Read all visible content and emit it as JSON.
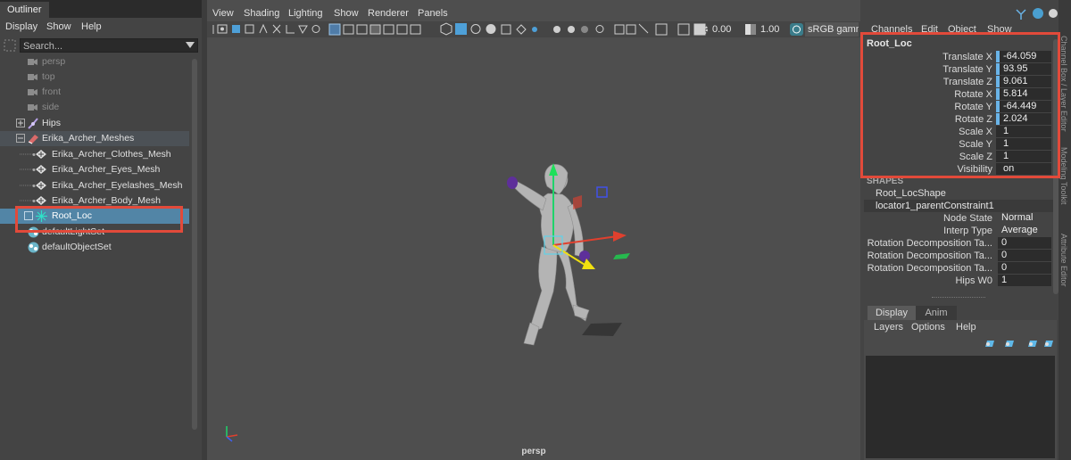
{
  "outliner": {
    "title": "Outliner",
    "menu": [
      "Display",
      "Show",
      "Help"
    ],
    "search_placeholder": "Search...",
    "items": [
      {
        "label": "persp",
        "icon": "camera-icon"
      },
      {
        "label": "top",
        "icon": "camera-icon"
      },
      {
        "label": "front",
        "icon": "camera-icon"
      },
      {
        "label": "side",
        "icon": "camera-icon"
      },
      {
        "label": "Hips",
        "icon": "joint-icon"
      },
      {
        "label": "Erika_Archer_Meshes",
        "icon": "group-icon"
      },
      {
        "label": "Erika_Archer_Clothes_Mesh",
        "icon": "mesh-icon"
      },
      {
        "label": "Erika_Archer_Eyes_Mesh",
        "icon": "mesh-icon"
      },
      {
        "label": "Erika_Archer_Eyelashes_Mesh",
        "icon": "mesh-icon"
      },
      {
        "label": "Erika_Archer_Body_Mesh",
        "icon": "mesh-icon"
      },
      {
        "label": "Root_Loc",
        "icon": "locator-icon"
      },
      {
        "label": "defaultLightSet",
        "icon": "set-icon"
      },
      {
        "label": "defaultObjectSet",
        "icon": "set-icon"
      }
    ]
  },
  "viewport": {
    "menu": [
      "View",
      "Shading",
      "Lighting",
      "Show",
      "Renderer",
      "Panels"
    ],
    "exposure": "0.00",
    "gamma": "1.00",
    "color_space": "sRGB gamm",
    "camera_label": "persp"
  },
  "channel_box": {
    "menu": [
      "Channels",
      "Edit",
      "Object",
      "Show"
    ],
    "node_name": "Root_Loc",
    "attributes": [
      {
        "name": "Translate X",
        "value": "-64.059"
      },
      {
        "name": "Translate Y",
        "value": "93.95"
      },
      {
        "name": "Translate Z",
        "value": "9.061"
      },
      {
        "name": "Rotate X",
        "value": "5.814"
      },
      {
        "name": "Rotate Y",
        "value": "-64.449"
      },
      {
        "name": "Rotate Z",
        "value": "2.024"
      },
      {
        "name": "Scale X",
        "value": "1"
      },
      {
        "name": "Scale Y",
        "value": "1"
      },
      {
        "name": "Scale Z",
        "value": "1"
      },
      {
        "name": "Visibility",
        "value": "on"
      }
    ],
    "shapes_header": "SHAPES",
    "shape_name": "Root_LocShape",
    "inputs_name": "locator1_parentConstraint1",
    "constraint_attrs": [
      {
        "name": "Node State",
        "value": "Normal"
      },
      {
        "name": "Interp Type",
        "value": "Average"
      },
      {
        "name": "Rotation Decomposition Ta...",
        "value": "0"
      },
      {
        "name": "Rotation Decomposition Ta...",
        "value": "0"
      },
      {
        "name": "Rotation Decomposition Ta...",
        "value": "0"
      },
      {
        "name": "Hips W0",
        "value": "1"
      }
    ],
    "layer_tabs": [
      "Display",
      "Anim"
    ],
    "layer_menu": [
      "Layers",
      "Options",
      "Help"
    ],
    "side_tabs": [
      "Channel Box / Layer Editor",
      "Modeling Toolkit",
      "Attribute Editor"
    ]
  },
  "colors": {
    "highlight": "#e24a3a",
    "selection": "#5285a6"
  }
}
